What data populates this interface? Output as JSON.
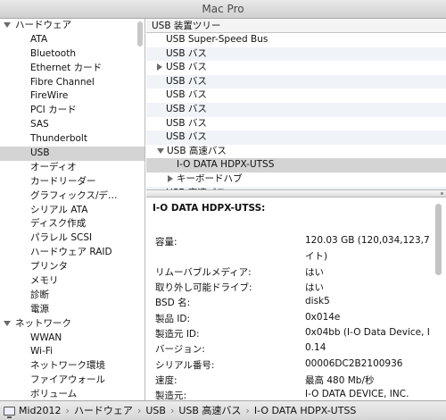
{
  "window": {
    "title": "Mac Pro"
  },
  "sidebar": {
    "rows": [
      {
        "label": "ハードウェア",
        "kind": "section"
      },
      {
        "label": "ATA",
        "kind": "item"
      },
      {
        "label": "Bluetooth",
        "kind": "item"
      },
      {
        "label": "Ethernet カード",
        "kind": "item"
      },
      {
        "label": "Fibre Channel",
        "kind": "item"
      },
      {
        "label": "FireWire",
        "kind": "item"
      },
      {
        "label": "PCI カード",
        "kind": "item"
      },
      {
        "label": "SAS",
        "kind": "item"
      },
      {
        "label": "Thunderbolt",
        "kind": "item"
      },
      {
        "label": "USB",
        "kind": "item",
        "selected": true
      },
      {
        "label": "オーディオ",
        "kind": "item"
      },
      {
        "label": "カードリーダー",
        "kind": "item"
      },
      {
        "label": "グラフィックス/デ…",
        "kind": "item"
      },
      {
        "label": "シリアル ATA",
        "kind": "item"
      },
      {
        "label": "ディスク作成",
        "kind": "item"
      },
      {
        "label": "パラレル SCSI",
        "kind": "item"
      },
      {
        "label": "ハードウェア RAID",
        "kind": "item"
      },
      {
        "label": "プリンタ",
        "kind": "item"
      },
      {
        "label": "メモリ",
        "kind": "item"
      },
      {
        "label": "診断",
        "kind": "item"
      },
      {
        "label": "電源",
        "kind": "item"
      },
      {
        "label": "ネットワーク",
        "kind": "section"
      },
      {
        "label": "WWAN",
        "kind": "item"
      },
      {
        "label": "Wi-Fi",
        "kind": "item"
      },
      {
        "label": "ネットワーク環境",
        "kind": "item"
      },
      {
        "label": "ファイアウォール",
        "kind": "item"
      },
      {
        "label": "ボリューム",
        "kind": "item"
      }
    ]
  },
  "tree": {
    "header": "USB 装置ツリー",
    "rows": [
      {
        "label": "USB Super-Speed Bus",
        "indent": 0,
        "toggle": "none"
      },
      {
        "label": "USB バス",
        "indent": 0,
        "toggle": "none"
      },
      {
        "label": "USB バス",
        "indent": 0,
        "toggle": "collapsed"
      },
      {
        "label": "USB バス",
        "indent": 0,
        "toggle": "none"
      },
      {
        "label": "USB バス",
        "indent": 0,
        "toggle": "none"
      },
      {
        "label": "USB バス",
        "indent": 0,
        "toggle": "none"
      },
      {
        "label": "USB バス",
        "indent": 0,
        "toggle": "none"
      },
      {
        "label": "USB バス",
        "indent": 0,
        "toggle": "none"
      },
      {
        "label": "USB 高速バス",
        "indent": 0,
        "toggle": "expanded"
      },
      {
        "label": "I-O DATA HDPX-UTSS",
        "indent": 1,
        "toggle": "none",
        "selected": true
      },
      {
        "label": "キーボードハブ",
        "indent": 1,
        "toggle": "collapsed"
      },
      {
        "label": "USB 高速バス",
        "indent": 0,
        "toggle": "collapsed"
      }
    ]
  },
  "detail": {
    "title": "I-O DATA HDPX-UTSS:",
    "rows": [
      {
        "key": "容量:",
        "value": "120.03 GB (120,034,123,7"
      },
      {
        "key": "",
        "value": "イト)"
      },
      {
        "key": "リムーバブルメディア:",
        "value": "はい"
      },
      {
        "key": "取り外し可能ドライブ:",
        "value": "はい"
      },
      {
        "key": "BSD 名:",
        "value": "disk5"
      },
      {
        "key": "製品 ID:",
        "value": "0x014e"
      },
      {
        "key": "製造元 ID:",
        "value": "0x04bb  (I-O Data Device, I"
      },
      {
        "key": "バージョン:",
        "value": " 0.14"
      },
      {
        "key": "シリアル番号:",
        "value": "00006DC2B2100936"
      },
      {
        "key": "速度:",
        "value": "最高 480 Mb/秒"
      },
      {
        "key": "製造元:",
        "value": "I-O DATA DEVICE, INC."
      }
    ]
  },
  "statusbar": {
    "crumbs": [
      "Mid2012",
      "ハードウェア",
      "USB",
      "USB 高速バス",
      "I-O DATA HDPX-UTSS"
    ]
  }
}
